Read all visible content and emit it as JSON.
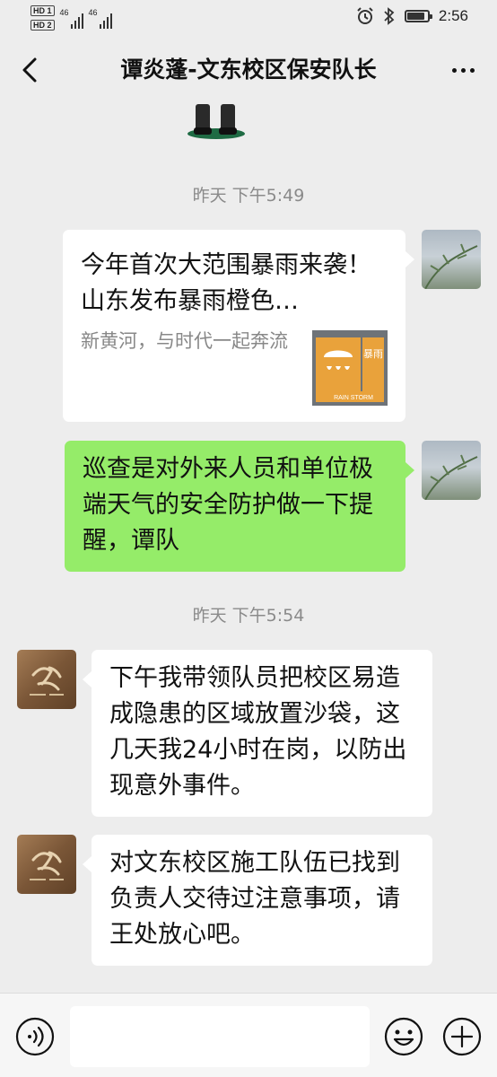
{
  "status_bar": {
    "hd1": "HD 1",
    "hd2": "HD 2",
    "signal1": "46",
    "signal2": "46",
    "time": "2:56",
    "battery_level": 0.8
  },
  "header": {
    "title": "谭炎蓬-文东校区保安队长"
  },
  "messages": [
    {
      "timestamp": "昨天 下午5:49"
    },
    {
      "type": "link",
      "sender": "self",
      "title": "今年首次大范围暴雨来袭！山东发布暴雨橙色…",
      "description": "新黄河，与时代一起奔流",
      "thumbnail": {
        "top_text": "暴雨",
        "bottom_text": "RAIN STORM"
      }
    },
    {
      "type": "text",
      "sender": "self",
      "text": "巡查是对外来人员和单位极端天气的安全防护做一下提醒，谭队"
    },
    {
      "timestamp": "昨天 下午5:54"
    },
    {
      "type": "text",
      "sender": "other",
      "text": "下午我带领队员把校区易造成隐患的区域放置沙袋，这几天我24小时在岗，以防出现意外事件。"
    },
    {
      "type": "text",
      "sender": "other",
      "text": "对文东校区施工队伍已找到负责人交待过注意事项，请王处放心吧。"
    }
  ],
  "input_bar": {
    "voice_icon": "voice-icon",
    "emoji_icon": "emoji-icon",
    "plus_icon": "plus-icon",
    "input_value": ""
  },
  "colors": {
    "background": "#ededed",
    "self_bubble": "#95ec69",
    "other_bubble": "#ffffff",
    "timestamp": "#8a8a8a"
  }
}
